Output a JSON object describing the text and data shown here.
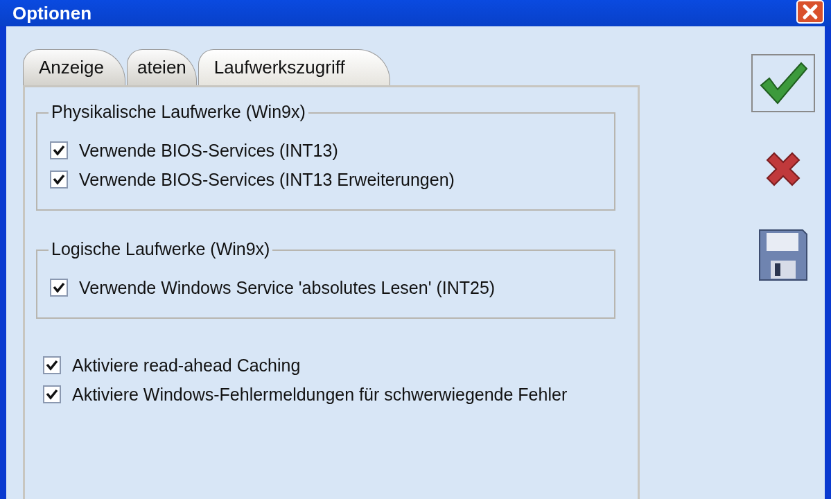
{
  "window": {
    "title": "Optionen"
  },
  "tabs": [
    {
      "label": "Anzeige",
      "selected": false
    },
    {
      "label": "ateien",
      "selected": false
    },
    {
      "label": "Laufwerkszugriff",
      "selected": true
    }
  ],
  "groups": [
    {
      "title": "Physikalische Laufwerke (Win9x)",
      "options": [
        {
          "label": "Verwende BIOS-Services (INT13)",
          "checked": true
        },
        {
          "label": "Verwende BIOS-Services (INT13 Erweiterungen)",
          "checked": true
        }
      ]
    },
    {
      "title": "Logische Laufwerke (Win9x)",
      "options": [
        {
          "label": "Verwende Windows Service 'absolutes Lesen' (INT25)",
          "checked": true
        }
      ]
    }
  ],
  "options": [
    {
      "label": "Aktiviere read-ahead Caching",
      "checked": true
    },
    {
      "label": "Aktiviere Windows-Fehlermeldungen für schwerwiegende Fehler",
      "checked": true
    }
  ],
  "buttons": [
    {
      "kind": "ok",
      "focused": true
    },
    {
      "kind": "cancel",
      "focused": false
    },
    {
      "kind": "save",
      "focused": false
    }
  ]
}
